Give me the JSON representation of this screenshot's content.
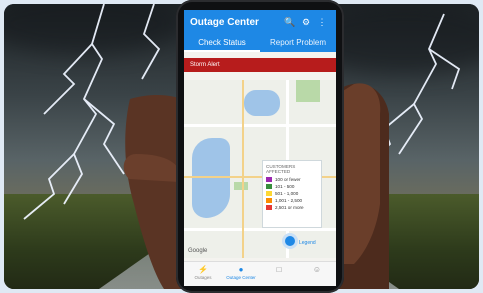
{
  "app": {
    "title": "Outage Center",
    "icons": [
      "search-icon",
      "gear-icon",
      "more-icon"
    ]
  },
  "tabs": [
    {
      "label": "Check Status",
      "active": true
    },
    {
      "label": "Report Problem",
      "active": false
    }
  ],
  "alert_bar": {
    "label": "Storm Alert"
  },
  "map": {
    "legend": {
      "header": "CUSTOMERS AFFECTED",
      "rows": [
        {
          "label": "100 or fewer",
          "color": "#9c27b0"
        },
        {
          "label": "101 - 500",
          "color": "#388e3c"
        },
        {
          "label": "501 - 1,000",
          "color": "#fdd835"
        },
        {
          "label": "1,001 - 2,500",
          "color": "#fb8c00"
        },
        {
          "label": "2,501 or more",
          "color": "#e53935"
        }
      ]
    },
    "legend_button": "Legend",
    "attribution": "Google"
  },
  "bottom_nav": [
    {
      "label": "Outages",
      "icon": "outages-icon",
      "active": false
    },
    {
      "label": "Outage Center",
      "icon": "outage-center-icon",
      "active": true
    },
    {
      "label": "",
      "icon": "pay-icon",
      "active": false
    },
    {
      "label": "",
      "icon": "account-icon",
      "active": false
    }
  ],
  "colors": {
    "brand": "#1e88e5",
    "alert": "#b71c1c"
  }
}
